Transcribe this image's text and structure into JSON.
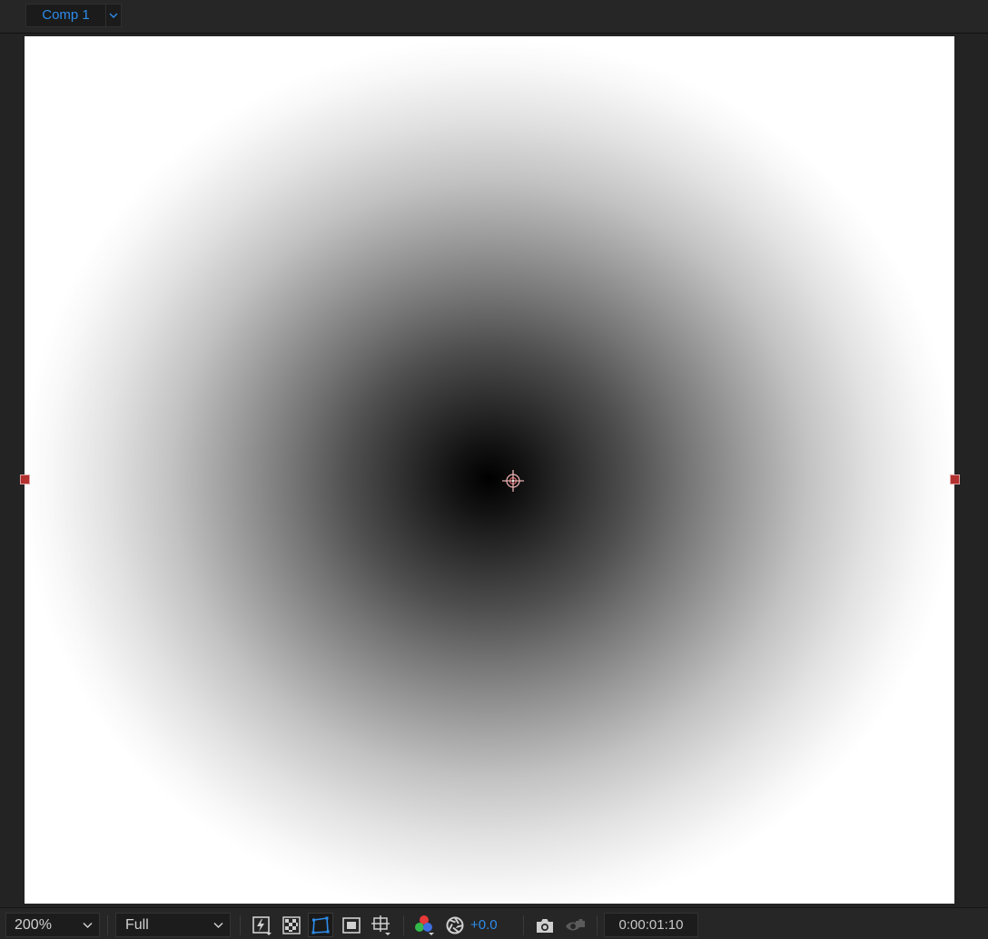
{
  "tab": {
    "title": "Comp 1"
  },
  "viewer": {
    "gradient_center_color": "#000000",
    "gradient_edge_color": "#ffffff",
    "handle_color": "#b3312f"
  },
  "toolbar": {
    "zoom": "200%",
    "resolution": "Full",
    "exposure": "+0.0",
    "timecode": "0:00:01:10",
    "accent_color": "#2d8ceb",
    "icons": [
      "fast-previews-icon",
      "transparency-grid-icon",
      "mask-path-visibility-icon",
      "region-of-interest-icon",
      "grid-guides-icon",
      "channel-rgb-icon",
      "color-management-icon",
      "snapshot-camera-icon",
      "show-snapshot-icon"
    ]
  }
}
